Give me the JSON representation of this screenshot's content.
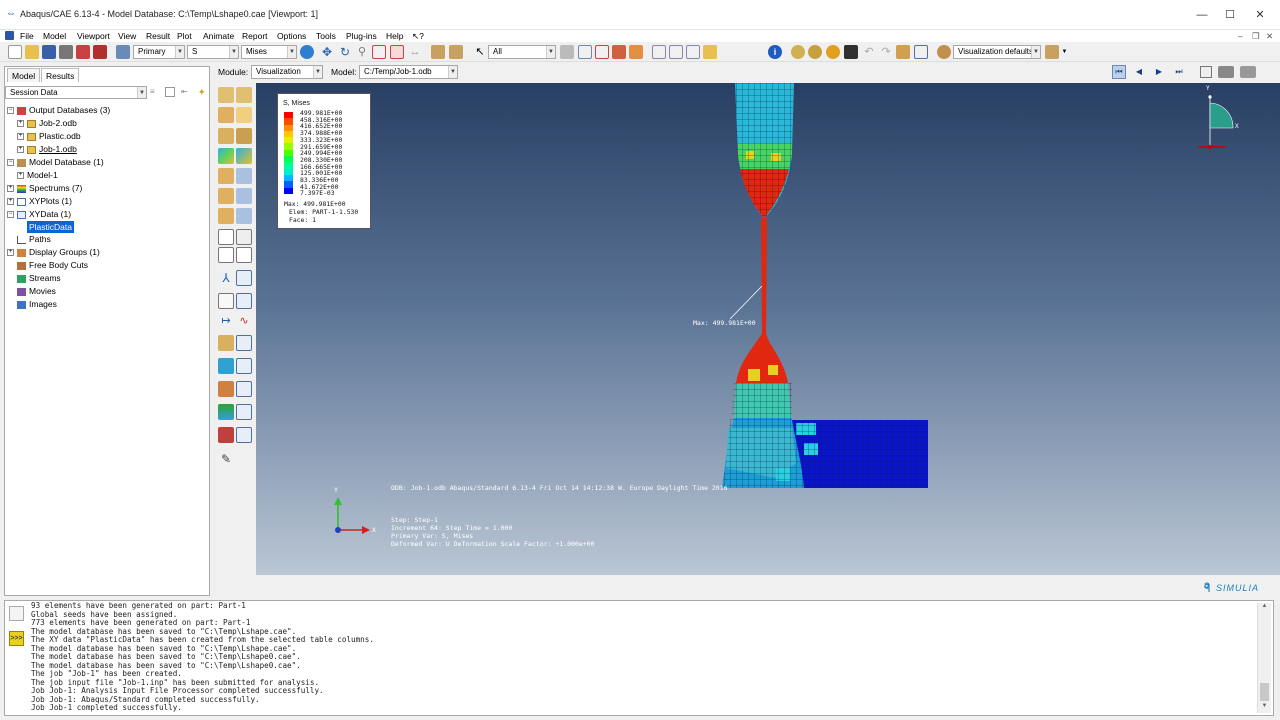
{
  "window": {
    "title": "Abaqus/CAE 6.13-4 - Model Database: C:\\Temp\\Lshape0.cae [Viewport: 1]"
  },
  "menu": [
    "File",
    "Model",
    "Viewport",
    "View",
    "Result",
    "Plot",
    "Animate",
    "Report",
    "Options",
    "Tools",
    "Plug-ins",
    "Help"
  ],
  "toolbar": {
    "primary": "Primary",
    "var": "S",
    "invariant": "Mises",
    "selection": "All",
    "viz_defaults": "Visualization defaults"
  },
  "context": {
    "module_label": "Module:",
    "module": "Visualization",
    "model_label": "Model:",
    "model": "C:/Temp/Job-1.odb"
  },
  "panel": {
    "tabs": [
      "Model",
      "Results"
    ],
    "session": "Session Data",
    "tree": [
      {
        "label": "Output Databases (3)"
      },
      {
        "label": "Job-2.odb"
      },
      {
        "label": "Plastic.odb"
      },
      {
        "label": "Job-1.odb"
      },
      {
        "label": "Model Database (1)"
      },
      {
        "label": "Model-1"
      },
      {
        "label": "Spectrums (7)"
      },
      {
        "label": "XYPlots (1)"
      },
      {
        "label": "XYData (1)"
      },
      {
        "label": "PlasticData"
      },
      {
        "label": "Paths"
      },
      {
        "label": "Display Groups (1)"
      },
      {
        "label": "Free Body Cuts"
      },
      {
        "label": "Streams"
      },
      {
        "label": "Movies"
      },
      {
        "label": "Images"
      }
    ]
  },
  "legend": {
    "title": "S, Mises",
    "values": [
      "499.981E+00",
      "458.316E+00",
      "416.652E+00",
      "374.988E+00",
      "333.323E+00",
      "291.659E+00",
      "249.994E+00",
      "208.330E+00",
      "166.665E+00",
      "125.001E+00",
      "83.336E+00",
      "41.672E+00",
      "7.397E-03"
    ],
    "colors": [
      "#ff0000",
      "#ff4a00",
      "#ff8e00",
      "#ffc800",
      "#e6f000",
      "#99ff00",
      "#4cff00",
      "#00ff4a",
      "#00ff99",
      "#00eecc",
      "#00b8ff",
      "#0060ff",
      "#0000ff"
    ],
    "max": "Max: 499.981E+00",
    "elem": "Elem: PART-1-1.530",
    "face": "Face: 1"
  },
  "viewport": {
    "max_label": "Max: 499.981E+00",
    "odb_line": "ODB: Job-1.odb    Abaqus/Standard 6.13-4    Fri Oct 14 14:12:38 W. Europe Daylight Time 2016",
    "step": "Step: Step-1",
    "increment": "Increment     64: Step Time =    1.000",
    "primary": "Primary Var: S, Mises",
    "deformed": "Deformed Var: U   Deformation Scale Factor: +1.000e+00",
    "axis_y": "Y",
    "axis_x": "X",
    "brand": "SIMULIA"
  },
  "messages": [
    "93 elements have been generated on part: Part-1",
    "Global seeds have been assigned.",
    "773 elements have been generated on part: Part-1",
    "The model database has been saved to \"C:\\Temp\\Lshape.cae\".",
    "The XY data \"PlasticData\" has been created from the selected table columns.",
    "The model database has been saved to \"C:\\Temp\\Lshape.cae\".",
    "The model database has been saved to \"C:\\Temp\\Lshape0.cae\".",
    "The model database has been saved to \"C:\\Temp\\Lshape0.cae\".",
    "The job \"Job-1\" has been created.",
    "The job input file \"Job-1.inp\" has been submitted for analysis.",
    "Job Job-1: Analysis Input File Processor completed successfully.",
    "Job Job-1: Abaqus/Standard completed successfully.",
    "Job Job-1 completed successfully."
  ]
}
